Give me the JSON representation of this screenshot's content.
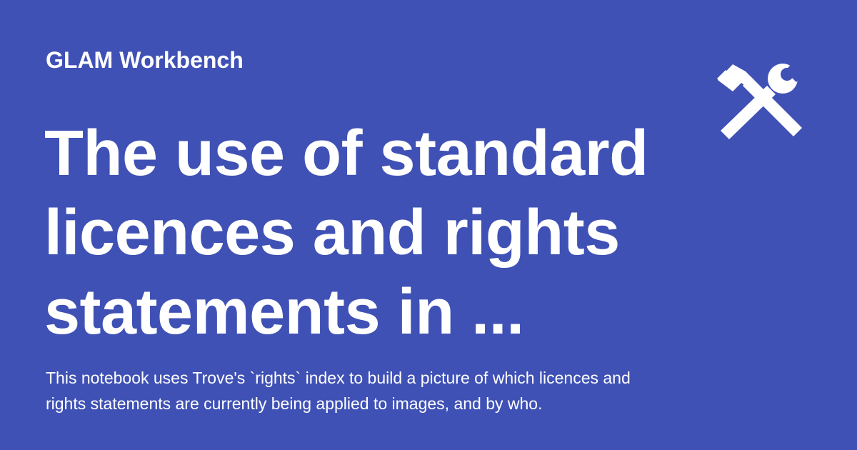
{
  "site": {
    "name": "GLAM Workbench",
    "logo_icon": "hammer-and-wrench-icon"
  },
  "page": {
    "title": "The use of standard licences and rights statements in ...",
    "description": "This notebook uses Trove's `rights` index to build a picture of which licences and rights statements are currently being applied to images, and by who."
  },
  "colors": {
    "background": "#3f51b5",
    "text": "#ffffff"
  }
}
